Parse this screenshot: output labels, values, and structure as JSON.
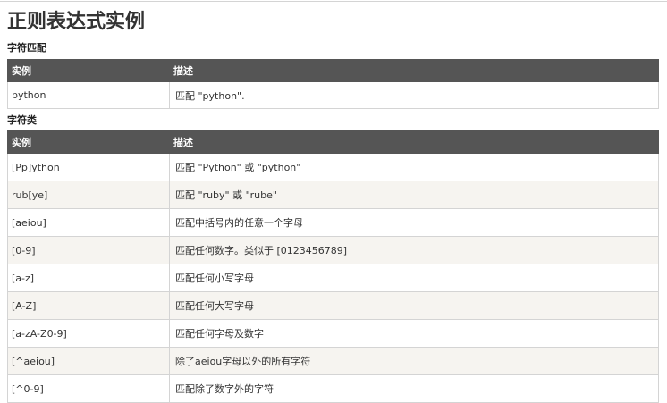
{
  "title": "正则表达式实例",
  "sections": [
    {
      "title": "字符匹配",
      "headers": [
        "实例",
        "描述"
      ],
      "rows": [
        [
          "python",
          "匹配 \"python\"."
        ]
      ]
    },
    {
      "title": "字符类",
      "headers": [
        "实例",
        "描述"
      ],
      "rows": [
        [
          "[Pp]ython",
          "匹配 \"Python\" 或 \"python\""
        ],
        [
          "rub[ye]",
          "匹配 \"ruby\" 或 \"rube\""
        ],
        [
          "[aeiou]",
          "匹配中括号内的任意一个字母"
        ],
        [
          "[0-9]",
          "匹配任何数字。类似于 [0123456789]"
        ],
        [
          "[a-z]",
          "匹配任何小写字母"
        ],
        [
          "[A-Z]",
          "匹配任何大写字母"
        ],
        [
          "[a-zA-Z0-9]",
          "匹配任何字母及数字"
        ],
        [
          "[^aeiou]",
          "除了aeiou字母以外的所有字符"
        ],
        [
          "[^0-9]",
          "匹配除了数字外的字符"
        ]
      ]
    }
  ]
}
